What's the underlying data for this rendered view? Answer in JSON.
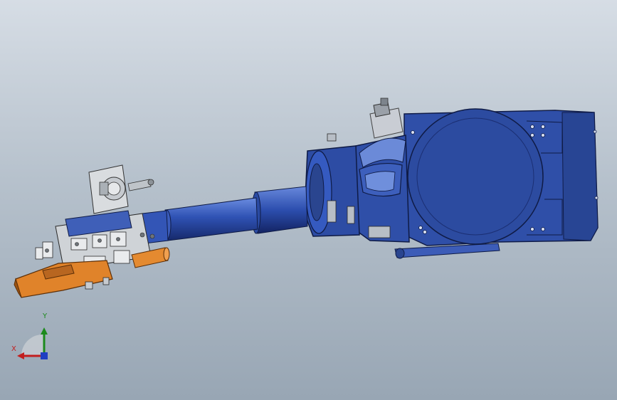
{
  "scene": {
    "background_top": "#d6dde5",
    "background_bottom": "#98a6b4",
    "colors": {
      "robot_blue": "#2f4fa8",
      "robot_blue_dark": "#1b2f73",
      "robot_blue_light": "#5c7ed0",
      "gripper_orange": "#e0832a",
      "gripper_orange_dark": "#9c5312",
      "metal_light": "#dcdcdc",
      "metal_dark": "#7a7a7a"
    }
  },
  "triad": {
    "x_label": "X",
    "y_label": "Y",
    "x_color": "#c21f1f",
    "y_color": "#1c8a1c",
    "z_color": "#1f3fc2"
  }
}
